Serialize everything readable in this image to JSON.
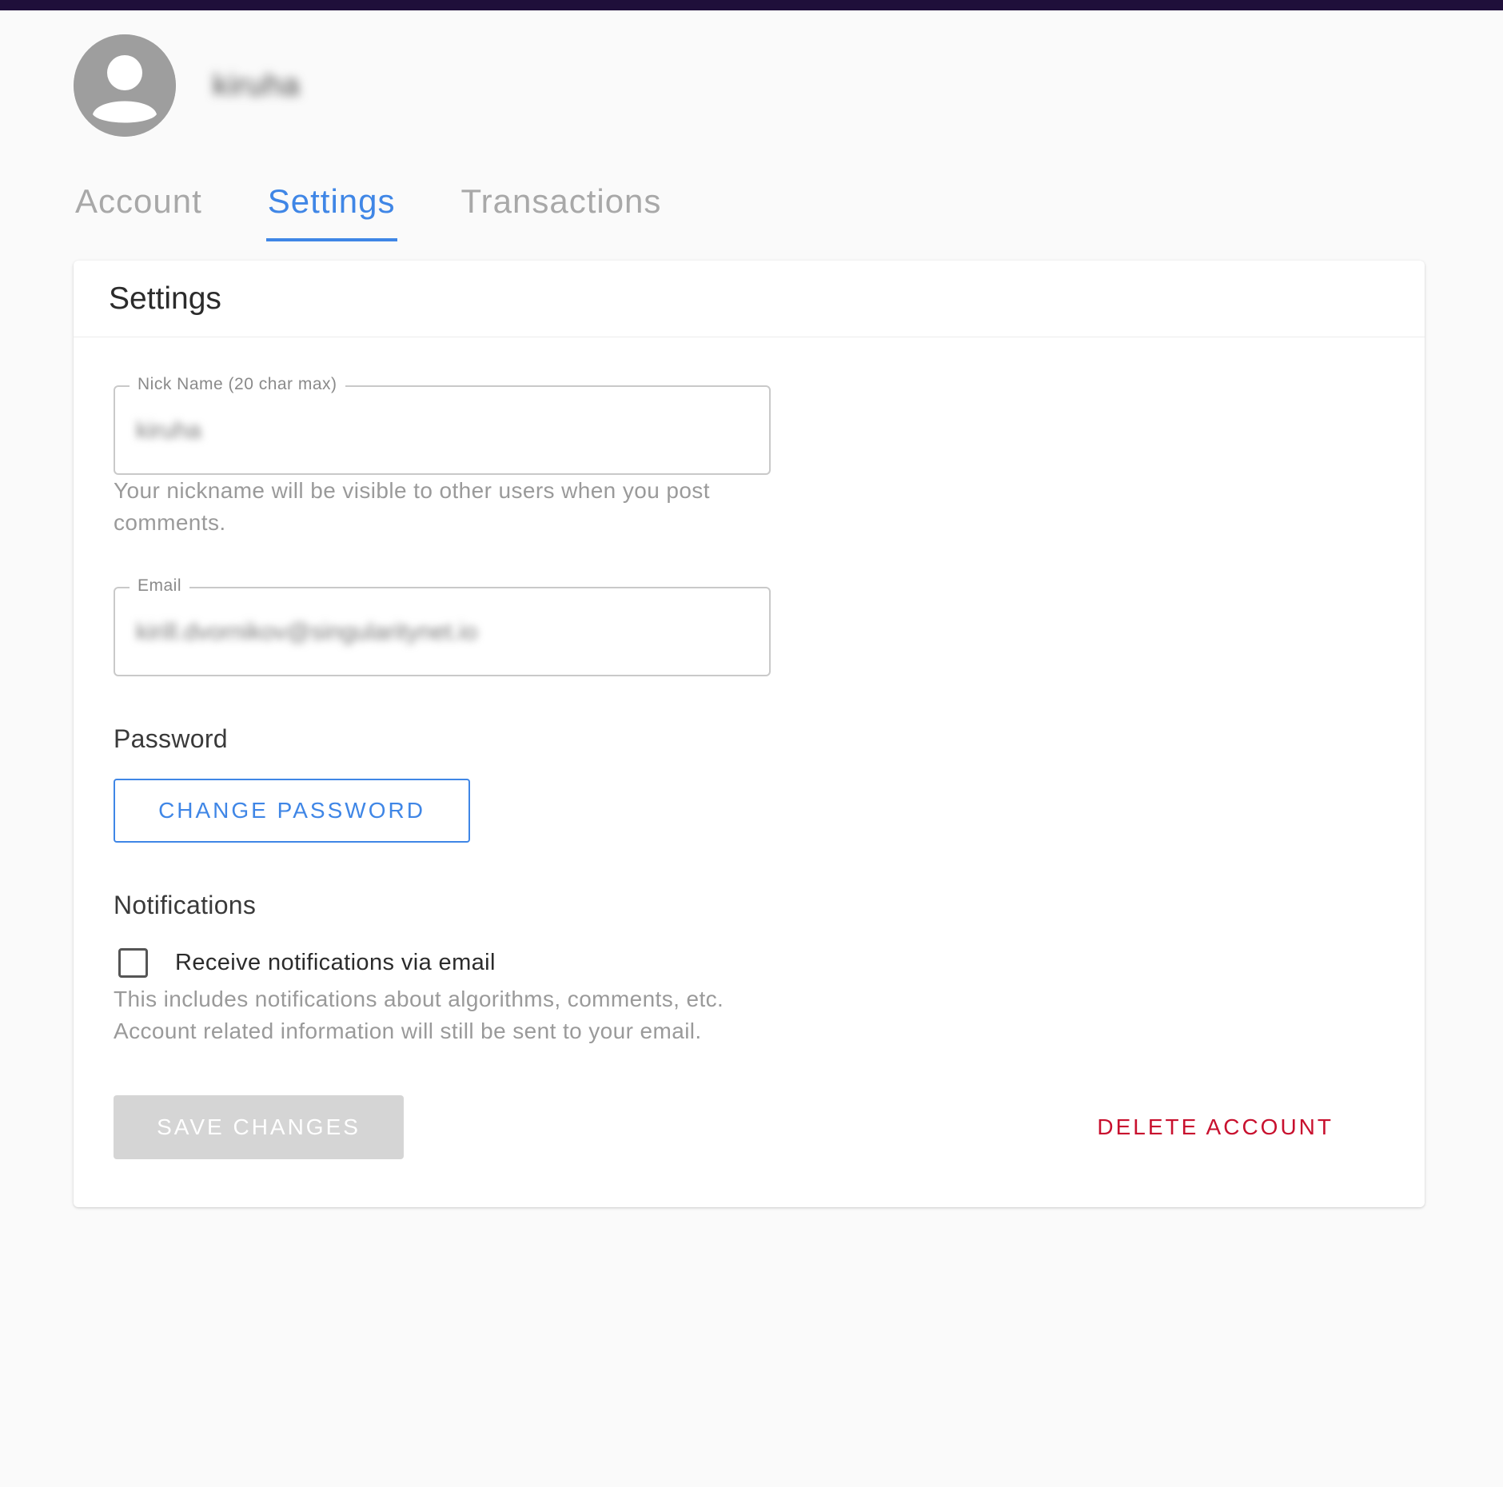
{
  "profile": {
    "avatar_icon": "account-circle-icon",
    "username": "kiruha"
  },
  "tabs": [
    {
      "label": "Account",
      "active": false
    },
    {
      "label": "Settings",
      "active": true
    },
    {
      "label": "Transactions",
      "active": false
    }
  ],
  "settings": {
    "title": "Settings",
    "nickname": {
      "label": "Nick Name (20 char max)",
      "value": "kiruha",
      "helper_line1": "Your nickname will be visible to other users when you post",
      "helper_line2": "comments."
    },
    "email": {
      "label": "Email",
      "value": "kirill.dvornikov@singularitynet.io"
    },
    "password": {
      "title": "Password",
      "change_button": "CHANGE PASSWORD"
    },
    "notifications": {
      "title": "Notifications",
      "checkbox_label": "Receive notifications via email",
      "checked": false,
      "helper_line1": "This includes notifications about algorithms, comments, etc.",
      "helper_line2": "Account related information will still be sent to your email."
    },
    "save_button": "SAVE CHANGES",
    "delete_button": "DELETE ACCOUNT"
  },
  "colors": {
    "topbar": "#1f0f3a",
    "accent": "#3f86e6",
    "danger": "#c8102e",
    "disabled": "#d5d5d5"
  }
}
